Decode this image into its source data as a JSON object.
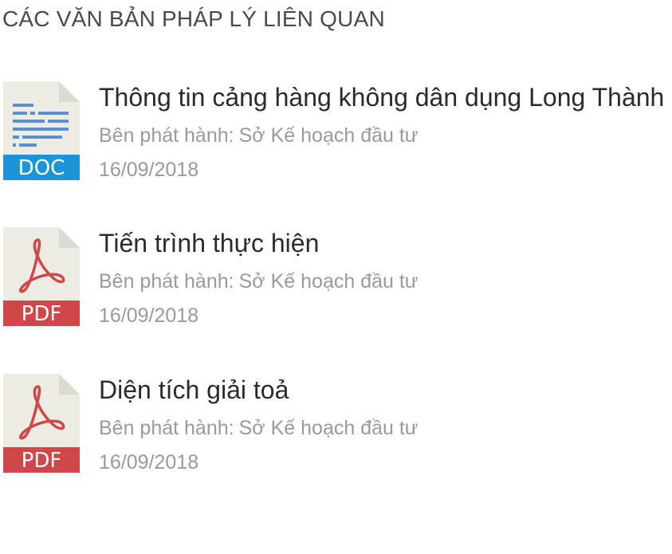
{
  "section": {
    "title": "CÁC VĂN BẢN PHÁP LÝ LIÊN QUAN"
  },
  "colors": {
    "doc_badge": "#1b95d6",
    "pdf_badge": "#d0474a",
    "page_fold": "#dcdbd2",
    "page_body": "#ecebe4"
  },
  "documents": [
    {
      "title": "Thông tin cảng hàng không dân dụng Long Thành",
      "issuer_label": "Bên phát hành:",
      "issuer": "Sở Kế hoạch đầu tư",
      "date": "16/09/2018",
      "file_type": "DOC",
      "icon": "doc-file-icon"
    },
    {
      "title": "Tiến trình thực hiện",
      "issuer_label": "Bên phát hành:",
      "issuer": "Sở Kế hoạch đầu tư",
      "date": "16/09/2018",
      "file_type": "PDF",
      "icon": "pdf-file-icon"
    },
    {
      "title": "Diện tích giải toả",
      "issuer_label": "Bên phát hành:",
      "issuer": "Sở Kế hoạch đầu tư",
      "date": "16/09/2018",
      "file_type": "PDF",
      "icon": "pdf-file-icon"
    }
  ]
}
